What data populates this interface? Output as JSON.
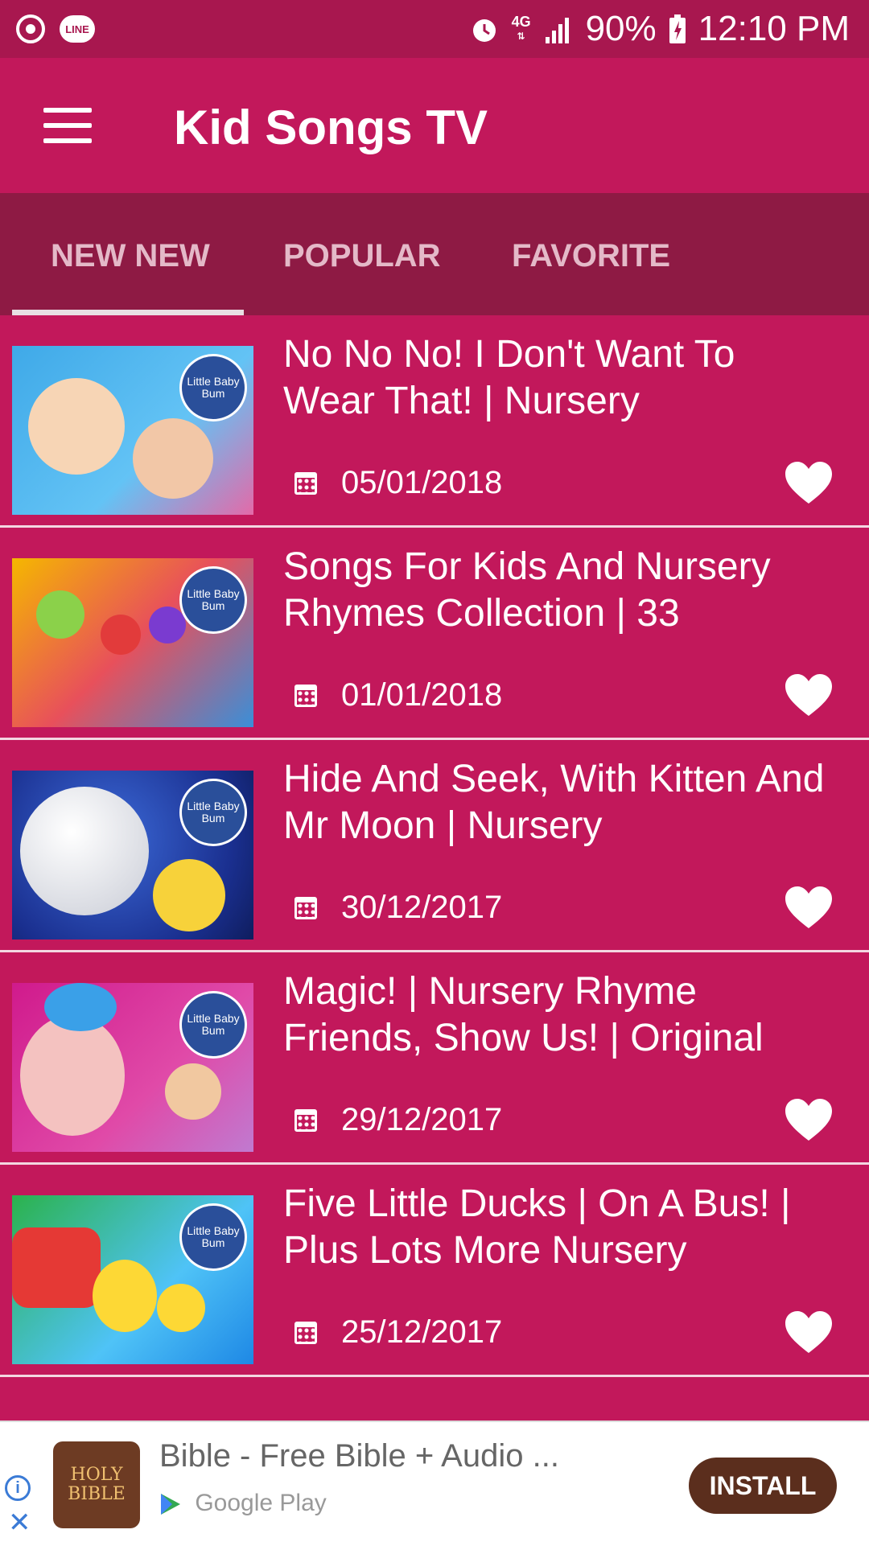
{
  "status_bar": {
    "network": "4G",
    "battery": "90%",
    "time": "12:10 PM",
    "line_badge": "LINE"
  },
  "app_bar": {
    "title": "Kid Songs TV"
  },
  "tabs": [
    {
      "label": "NEW NEW",
      "selected": true
    },
    {
      "label": "POPULAR",
      "selected": false
    },
    {
      "label": "FAVORITE",
      "selected": false
    }
  ],
  "videos": [
    {
      "title": "No No No! I Don't Want To Wear That! | Nursery",
      "date": "05/01/2018"
    },
    {
      "title": "Songs For Kids And Nursery Rhymes Collection | 33",
      "date": "01/01/2018"
    },
    {
      "title": "Hide And Seek, With Kitten And Mr Moon | Nursery",
      "date": "30/12/2017"
    },
    {
      "title": "Magic! | Nursery Rhyme Friends, Show Us! | Original",
      "date": "29/12/2017"
    },
    {
      "title": "Five Little Ducks | On A Bus! | Plus Lots More Nursery",
      "date": "25/12/2017"
    }
  ],
  "thumbnail_badge": "Little Baby Bum",
  "ad": {
    "icon_text_line1": "HOLY",
    "icon_text_line2": "BIBLE",
    "title": "Bible - Free Bible + Audio ...",
    "subtitle": "Google Play",
    "button_label": "INSTALL"
  },
  "colors": {
    "primary": "#c2185b",
    "status_bar": "#a8174f",
    "tab_bar": "#8e1a44",
    "ad_button": "#5b2e1d"
  }
}
